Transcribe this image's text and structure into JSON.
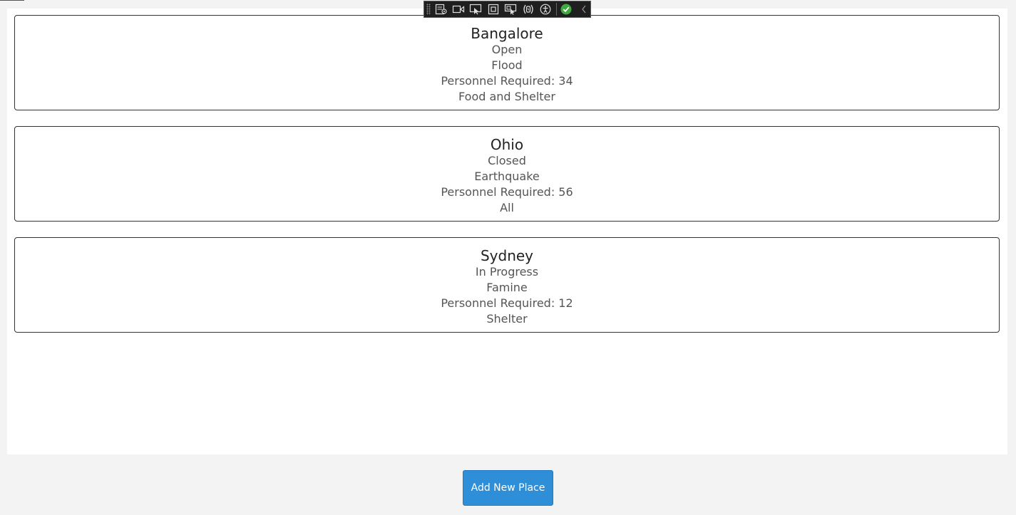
{
  "places": [
    {
      "city": "Bangalore",
      "status": "Open",
      "disaster": "Flood",
      "personnel": "Personnel Required: 34",
      "needs": "Food and Shelter"
    },
    {
      "city": "Ohio",
      "status": "Closed",
      "disaster": "Earthquake",
      "personnel": "Personnel Required: 56",
      "needs": "All"
    },
    {
      "city": "Sydney",
      "status": "In Progress",
      "disaster": "Famine",
      "personnel": "Personnel Required: 12",
      "needs": "Shelter"
    }
  ],
  "actions": {
    "add_place_label": "Add New Place"
  },
  "toolbar": {
    "icons": [
      "live-visual-tree-icon",
      "video-record-icon",
      "select-element-icon",
      "display-layout-adorners-icon",
      "track-focused-element-icon",
      "binding-failures-icon",
      "accessibility-checker-icon",
      "no-issues-check-icon",
      "collapse-toolbar-icon"
    ],
    "accent_green": "#3fa93f"
  },
  "colors": {
    "button_bg": "#2e8fd8",
    "page_bg": "#f3f3f3",
    "panel_bg": "#ffffff"
  }
}
